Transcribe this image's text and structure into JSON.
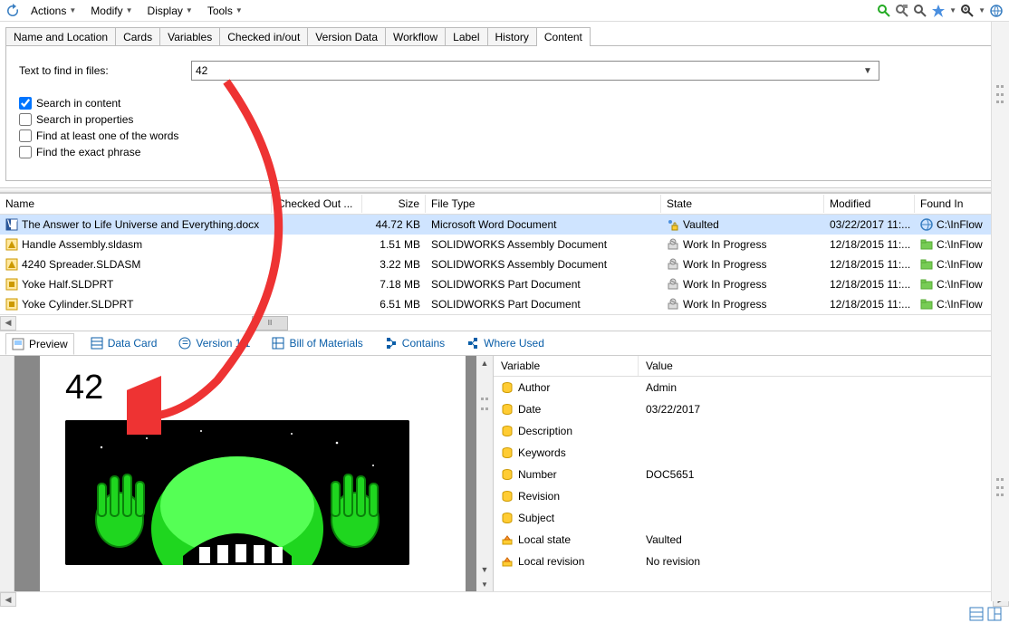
{
  "menus": {
    "actions": "Actions",
    "modify": "Modify",
    "display": "Display",
    "tools": "Tools"
  },
  "search_tabs": [
    "Name and Location",
    "Cards",
    "Variables",
    "Checked in/out",
    "Version Data",
    "Workflow",
    "Label",
    "History",
    "Content"
  ],
  "search_tabs_active": 8,
  "search": {
    "label": "Text to find in files:",
    "value": "42",
    "opt_content": "Search in content",
    "opt_properties": "Search in properties",
    "opt_oneword": "Find at least one of the words",
    "opt_exact": "Find the exact phrase"
  },
  "grid": {
    "headers": {
      "name": "Name",
      "checkedout": "Checked Out ...",
      "size": "Size",
      "filetype": "File Type",
      "state": "State",
      "modified": "Modified",
      "foundin": "Found In"
    },
    "rows": [
      {
        "name": "The Answer to Life Universe and Everything.docx",
        "checkedout": "",
        "size": "44.72 KB",
        "filetype": "Microsoft Word Document",
        "state": "Vaulted",
        "modified": "03/22/2017 11:...",
        "foundin": "C:\\InFlow"
      },
      {
        "name": "Handle Assembly.sldasm",
        "checkedout": "",
        "size": "1.51 MB",
        "filetype": "SOLIDWORKS Assembly Document",
        "state": "Work In Progress",
        "modified": "12/18/2015 11:...",
        "foundin": "C:\\InFlow"
      },
      {
        "name": "4240 Spreader.SLDASM",
        "checkedout": "",
        "size": "3.22 MB",
        "filetype": "SOLIDWORKS Assembly Document",
        "state": "Work In Progress",
        "modified": "12/18/2015 11:...",
        "foundin": "C:\\InFlow"
      },
      {
        "name": "Yoke Half.SLDPRT",
        "checkedout": "",
        "size": "7.18 MB",
        "filetype": "SOLIDWORKS Part Document",
        "state": "Work In Progress",
        "modified": "12/18/2015 11:...",
        "foundin": "C:\\InFlow"
      },
      {
        "name": "Yoke Cylinder.SLDPRT",
        "checkedout": "",
        "size": "6.51 MB",
        "filetype": "SOLIDWORKS Part Document",
        "state": "Work In Progress",
        "modified": "12/18/2015 11:...",
        "foundin": "C:\\InFlow"
      }
    ]
  },
  "lower_tabs": {
    "preview": "Preview",
    "datacard": "Data Card",
    "version": "Version 1/1",
    "bom": "Bill of Materials",
    "contains": "Contains",
    "whereused": "Where Used"
  },
  "preview_doc": {
    "big_text": "42"
  },
  "props": {
    "headers": {
      "variable": "Variable",
      "value": "Value"
    },
    "rows": [
      {
        "icon": "db",
        "variable": "Author",
        "value": "Admin"
      },
      {
        "icon": "db",
        "variable": "Date",
        "value": "03/22/2017"
      },
      {
        "icon": "db",
        "variable": "Description",
        "value": ""
      },
      {
        "icon": "db",
        "variable": "Keywords",
        "value": ""
      },
      {
        "icon": "db",
        "variable": "Number",
        "value": "DOC5651"
      },
      {
        "icon": "db",
        "variable": "Revision",
        "value": ""
      },
      {
        "icon": "db",
        "variable": "Subject",
        "value": ""
      },
      {
        "icon": "local",
        "variable": "Local state",
        "value": "Vaulted"
      },
      {
        "icon": "local",
        "variable": "Local revision",
        "value": "No revision"
      }
    ]
  }
}
